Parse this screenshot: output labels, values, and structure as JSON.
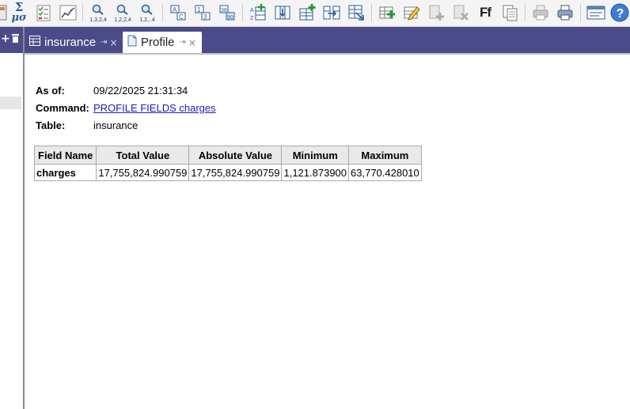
{
  "toolbar": {
    "icons": [
      "calculator-icon",
      "sigma-statistics-icon",
      "checklist-icon",
      "line-chart-icon",
      "sample-1-icon",
      "sample-2-icon",
      "sample-3-icon",
      "sort-az-icon",
      "sort-numeric-icon",
      "sort-numeric-alt-icon",
      "add-column-icon",
      "insert-column-icon",
      "append-icon",
      "join-icon",
      "select-range-icon",
      "new-table-icon",
      "edit-table-icon",
      "add-record-icon",
      "delete-record-icon",
      "fonts-icon",
      "copy-icon",
      "print-icon",
      "print-preview-icon",
      "window-icon",
      "help-icon"
    ],
    "sample_labels": [
      "1,3,2,4",
      "1,2,2,4",
      "1,2,..4"
    ],
    "fonts_label": "Ff"
  },
  "tabs": [
    {
      "label": "insurance",
      "icon": "table-icon",
      "active": false
    },
    {
      "label": "Profile",
      "icon": "document-icon",
      "active": true
    }
  ],
  "profile": {
    "as_of_label": "As of:",
    "as_of_value": "09/22/2025 21:31:34",
    "command_label": "Command:",
    "command_value": "PROFILE FIELDS charges",
    "table_label": "Table:",
    "table_value": "insurance",
    "columns": [
      "Field Name",
      "Total Value",
      "Absolute Value",
      "Minimum",
      "Maximum"
    ],
    "rows": [
      [
        "charges",
        "17,755,824.990759",
        "17,755,824.990759",
        "1,121.873900",
        "63,770.428010"
      ]
    ]
  },
  "colors": {
    "tab_strip": "#4b4b8a",
    "link": "#1a1acc",
    "header_bg": "#e9e9e9"
  }
}
